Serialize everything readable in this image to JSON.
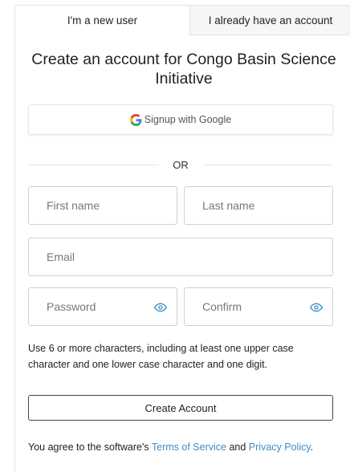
{
  "tabs": {
    "new_user": "I'm a new user",
    "existing_user": "I already have an account"
  },
  "title": "Create an account for Congo Basin Science Initiative",
  "google_button": {
    "label": "Signup with Google",
    "icon": "google-g-icon"
  },
  "divider": {
    "text": "OR"
  },
  "fields": {
    "first_name": {
      "placeholder": "First name",
      "value": ""
    },
    "last_name": {
      "placeholder": "Last name",
      "value": ""
    },
    "email": {
      "placeholder": "Email",
      "value": ""
    },
    "password": {
      "placeholder": "Password",
      "value": "",
      "icon": "eye-icon"
    },
    "confirm": {
      "placeholder": "Confirm",
      "value": "",
      "icon": "eye-icon"
    }
  },
  "password_hint": "Use 6 or more characters, including at least one upper case character and one lower case character and one digit.",
  "create_button": "Create Account",
  "agreement": {
    "prefix": "You agree to the software's ",
    "terms_link": "Terms of Service",
    "middle": " and ",
    "privacy_link": "Privacy Policy",
    "suffix": "."
  },
  "colors": {
    "link": "#3b8fc9",
    "eye_icon": "#3b8fc9",
    "border": "#d0d0d0",
    "tab_inactive_bg": "#f6f6f6"
  }
}
